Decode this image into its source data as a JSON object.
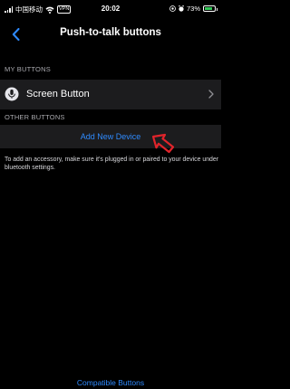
{
  "status_bar": {
    "carrier": "中国移动",
    "vpn": "VPN",
    "time": "20:02",
    "battery": "73%"
  },
  "nav": {
    "title": "Push-to-talk buttons"
  },
  "my_buttons": {
    "header": "MY BUTTONS",
    "items": [
      {
        "label": "Screen Button",
        "icon": "microphone-icon"
      }
    ]
  },
  "other_buttons": {
    "header": "OTHER BUTTONS",
    "add_device_label": "Add New Device",
    "hint": "To add an accessory, make sure it's plugged in or paired to your device under bluetooth settings."
  },
  "footer": {
    "compatible_label": "Compatible Buttons"
  },
  "colors": {
    "accent": "#2f8bff",
    "background": "#000000",
    "row_background": "#1c1c1e",
    "annotation": "#e0242b"
  }
}
